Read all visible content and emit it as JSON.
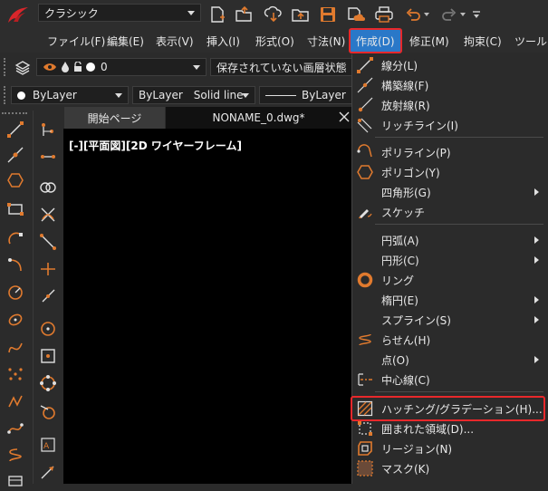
{
  "workspace": {
    "value": "クラシック"
  },
  "menubar": {
    "items": [
      "ファイル(F)",
      "編集(E)",
      "表示(V)",
      "挿入(I)",
      "形式(O)",
      "寸法(N)",
      "作成(D)",
      "修正(M)",
      "拘束(C)",
      "ツール("
    ]
  },
  "layer_bar": {
    "layer_value": "0",
    "layer_state": "保存されていない画層状態"
  },
  "prop_bar": {
    "color": "ByLayer",
    "linetype": "ByLayer",
    "linetype_name": "Solid line",
    "lineweight": "ByLayer"
  },
  "tabs": [
    "開始ページ",
    "NONAME_0.dwg*"
  ],
  "canvas": {
    "view_label": "[-][平面図][2D ワイヤーフレーム]"
  },
  "dropdown": {
    "items": [
      {
        "label": "線分(L)",
        "icon": "line-icon",
        "submenu": false
      },
      {
        "label": "構築線(F)",
        "icon": "construction-line-icon",
        "submenu": false
      },
      {
        "label": "放射線(R)",
        "icon": "ray-icon",
        "submenu": false
      },
      {
        "label": "リッチライン(I)",
        "icon": "multiline-icon",
        "submenu": false
      },
      {
        "label": "ポリライン(P)",
        "icon": "polyline-icon",
        "submenu": false
      },
      {
        "label": "ポリゴン(Y)",
        "icon": "polygon-icon",
        "submenu": false
      },
      {
        "label": "四角形(G)",
        "icon": "",
        "submenu": true
      },
      {
        "label": "スケッチ",
        "icon": "sketch-icon",
        "submenu": false
      },
      {
        "label": "円弧(A)",
        "icon": "",
        "submenu": true
      },
      {
        "label": "円形(C)",
        "icon": "",
        "submenu": true
      },
      {
        "label": "リング",
        "icon": "donut-icon",
        "submenu": false
      },
      {
        "label": "楕円(E)",
        "icon": "",
        "submenu": true
      },
      {
        "label": "スプライン(S)",
        "icon": "",
        "submenu": true
      },
      {
        "label": "らせん(H)",
        "icon": "helix-icon",
        "submenu": false
      },
      {
        "label": "点(O)",
        "icon": "",
        "submenu": true
      },
      {
        "label": "中心線(C)",
        "icon": "centerline-icon",
        "submenu": false
      },
      {
        "label": "ハッチング/グラデーション(H)...",
        "icon": "hatch-icon",
        "submenu": false
      },
      {
        "label": "囲まれた領域(D)...",
        "icon": "boundary-icon",
        "submenu": false
      },
      {
        "label": "リージョン(N)",
        "icon": "region-icon",
        "submenu": false
      },
      {
        "label": "マスク(K)",
        "icon": "wipeout-icon",
        "submenu": false
      }
    ]
  },
  "colors": {
    "accent": "#e07a2e",
    "highlight": "#2a78c8",
    "callout": "#e8282b"
  }
}
